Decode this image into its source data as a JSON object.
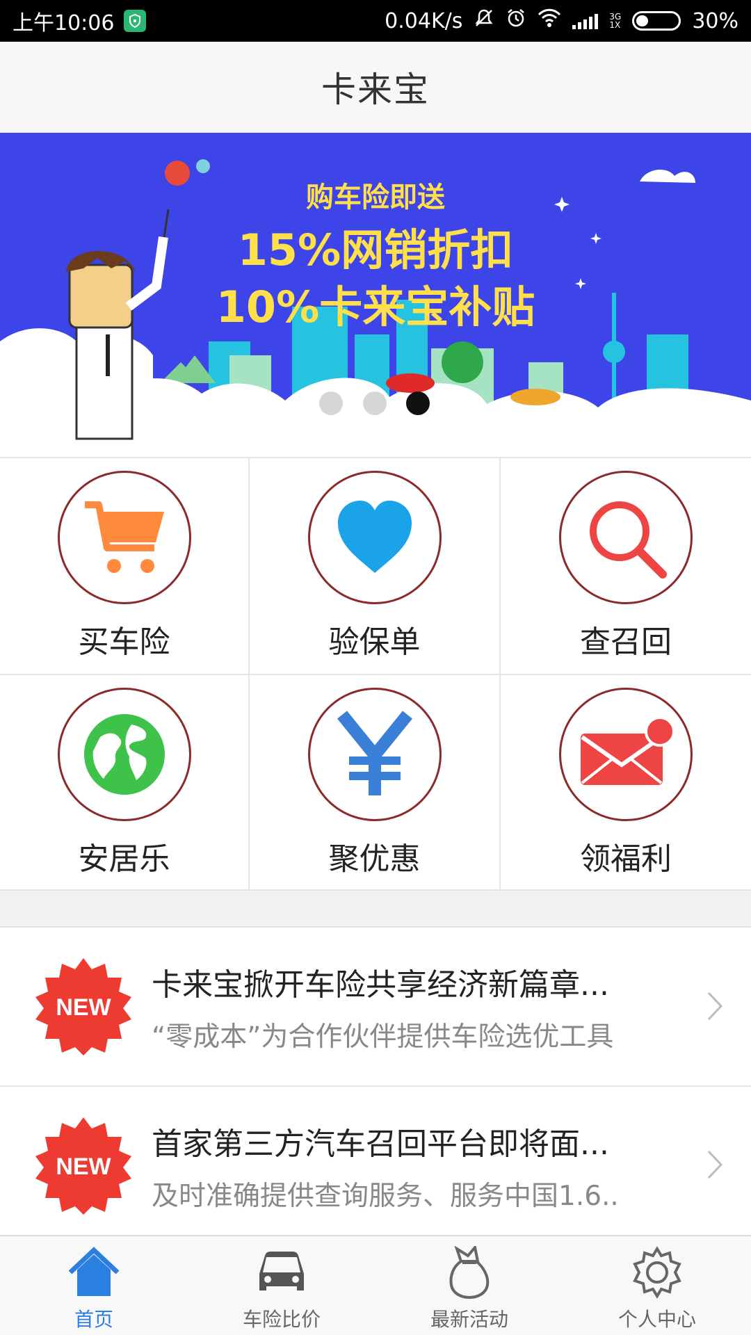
{
  "status_bar": {
    "time": "上午10:06",
    "net_speed": "0.04K/s",
    "network_tag_top": "3G",
    "network_tag_bottom": "1X",
    "battery": "30%",
    "battery_level": 0.3,
    "icons": [
      "shield-icon",
      "mute-icon",
      "alarm-icon",
      "wifi-icon",
      "signal-icon",
      "battery-icon"
    ]
  },
  "header": {
    "title": "卡来宝"
  },
  "banner": {
    "line1": "购车险即送",
    "line2": "15%网销折扣",
    "line3": "10%卡来宝补贴",
    "colors": {
      "background": "#3d44e8",
      "text": "#ffe04a"
    },
    "page_count": 3,
    "active_page": 3
  },
  "grid": {
    "items": [
      {
        "label": "买车险",
        "icon": "cart-icon",
        "color": "#ff8a3d"
      },
      {
        "label": "验保单",
        "icon": "heart-icon",
        "color": "#1aa3e8"
      },
      {
        "label": "查召回",
        "icon": "search-icon",
        "color": "#ee4444"
      },
      {
        "label": "安居乐",
        "icon": "globe-icon",
        "color": "#3ec24a"
      },
      {
        "label": "聚优惠",
        "icon": "yen-icon",
        "color": "#3a7fd8"
      },
      {
        "label": "领福利",
        "icon": "mail-icon",
        "color": "#ee4444"
      }
    ],
    "border_color": "#8b2a2a"
  },
  "news": [
    {
      "badge": "NEW",
      "title": "卡来宝掀开车险共享经济新篇章...",
      "subtitle": "“零成本”为合作伙伴提供车险选优工具"
    },
    {
      "badge": "NEW",
      "title": "首家第三方汽车召回平台即将面...",
      "subtitle": "及时准确提供查询服务、服务中国1.6.."
    }
  ],
  "tabs": [
    {
      "label": "首页",
      "icon": "home-icon",
      "active": true
    },
    {
      "label": "车险比价",
      "icon": "car-icon",
      "active": false
    },
    {
      "label": "最新活动",
      "icon": "gift-bag-icon",
      "active": false
    },
    {
      "label": "个人中心",
      "icon": "gear-icon",
      "active": false
    }
  ],
  "colors": {
    "accent": "#2b7fe0",
    "badge_red": "#ee3b32"
  }
}
